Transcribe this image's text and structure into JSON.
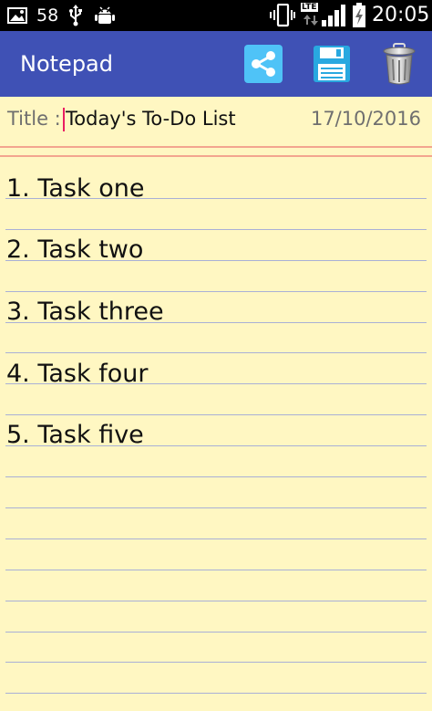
{
  "status_bar": {
    "notification_count": "58",
    "network_label": "LTE",
    "time": "20:05"
  },
  "app_bar": {
    "title": "Notepad",
    "actions": [
      {
        "name": "share",
        "icon": "share-icon"
      },
      {
        "name": "save",
        "icon": "floppy-disk-icon"
      },
      {
        "name": "delete",
        "icon": "trash-can-icon"
      }
    ]
  },
  "note": {
    "title_label": "Title :",
    "title_value": "Today's To-Do List",
    "date": "17/10/2016",
    "lines": [
      "1. Task one",
      "2. Task two",
      "3. Task three",
      "4. Task four",
      "5. Task five"
    ]
  },
  "colors": {
    "app_bar": "#3f51b5",
    "paper": "#fff7c2",
    "ruled_line": "#a9b0d6",
    "margin_line": "#f3a58f",
    "caret": "#e91e63",
    "share_icon_bg": "#4fc3f7"
  }
}
